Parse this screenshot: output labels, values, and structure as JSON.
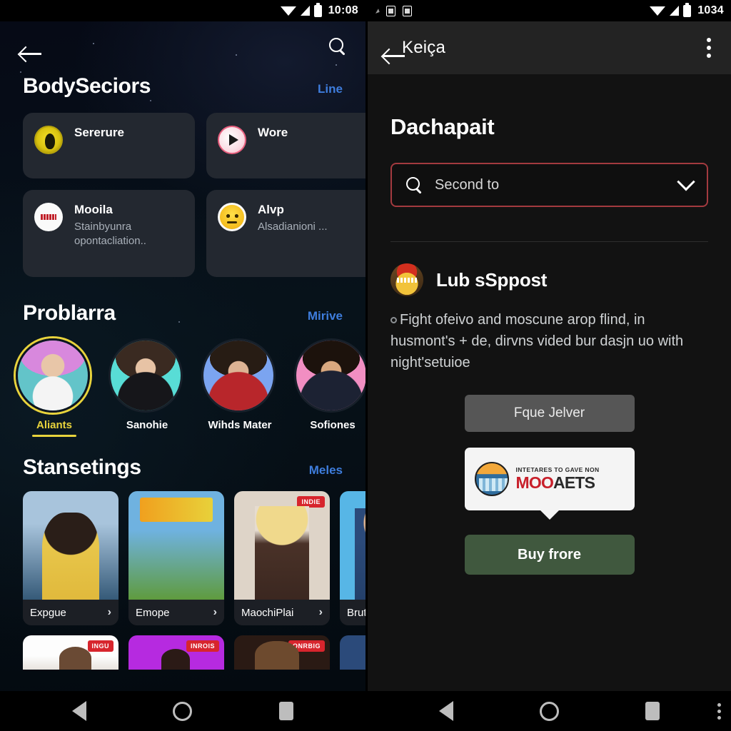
{
  "left": {
    "status": {
      "time": "10:08",
      "wifi_icon": "wifi-icon",
      "signal_icon": "signal-icon",
      "battery_icon": "battery-icon"
    },
    "topbar": {
      "back_icon": "back-arrow-icon",
      "search_icon": "search-icon"
    },
    "sections": [
      {
        "title": "BodySeciors",
        "link": "Line"
      },
      {
        "title": "Problarra",
        "link": "Mirive"
      },
      {
        "title": "Stansetings",
        "link": "Meles"
      }
    ],
    "cards": [
      {
        "title": "Sererure",
        "sub": "",
        "icon": "shield-badge-icon"
      },
      {
        "title": "Wore",
        "sub": "",
        "icon": "play-circle-icon"
      },
      {
        "title": "Mooila",
        "sub": "Stainbyunra opontacliation..",
        "icon": "news-circle-icon"
      },
      {
        "title": "Alvp",
        "sub": "Alsadianioni ...",
        "icon": "emoji-neutral-icon"
      }
    ],
    "avatars": [
      {
        "label": "Aliants",
        "active": true
      },
      {
        "label": "Sanohie",
        "active": false
      },
      {
        "label": "Wihds Mater",
        "active": false
      },
      {
        "label": "Sofiones",
        "active": false
      }
    ],
    "thumbs": [
      {
        "label": "Expgue",
        "badge": "",
        "chevron": "chevron-right-icon"
      },
      {
        "label": "Emope",
        "badge": "",
        "chevron": "chevron-right-icon"
      },
      {
        "label": "MaochiPlai",
        "badge": "INDIE",
        "chevron": "chevron-right-icon"
      },
      {
        "label": "Brut",
        "badge": "",
        "chevron": "chevron-right-icon"
      }
    ],
    "thumbs_row2": [
      {
        "badge": "INGU"
      },
      {
        "badge": "INROIS"
      },
      {
        "badge": "ONRBIG"
      },
      {
        "badge": ""
      }
    ]
  },
  "right": {
    "status": {
      "time": "1034",
      "notif_icons": [
        "sim-card-icon",
        "sd-card-icon"
      ],
      "wifi_icon": "wifi-icon",
      "signal_icon": "signal-icon",
      "battery_icon": "battery-icon"
    },
    "topbar": {
      "back_icon": "back-arrow-icon",
      "title": "Keiça",
      "overflow_icon": "more-vertical-icon"
    },
    "heading": "Dachapait",
    "search": {
      "icon": "search-icon",
      "value": "Second to",
      "dropdown_icon": "chevron-down-icon",
      "border_color": "#a33a3f"
    },
    "post": {
      "avatar_icon": "brand-avatar-icon",
      "title": "Lub sSppost",
      "body": "Fight ofeivo and moscune arop flind, in husmont's + de, dirvns vided bur dasjn uo with night'setuioe"
    },
    "buttons": {
      "secondary": "Fque Jelver",
      "primary": "Buy frore",
      "primary_color": "#40583e",
      "secondary_color": "#565656"
    },
    "promo": {
      "logo_icon": "maple-lake-logo-icon",
      "kicker": "INTETARES TO GAVE NON",
      "brand_red": "MOO",
      "brand_dark": "AETS"
    }
  },
  "navbar": {
    "back_icon": "nav-back-icon",
    "home_icon": "nav-home-icon",
    "recents_icon": "nav-recents-icon",
    "overflow_icon": "nav-overflow-icon"
  }
}
